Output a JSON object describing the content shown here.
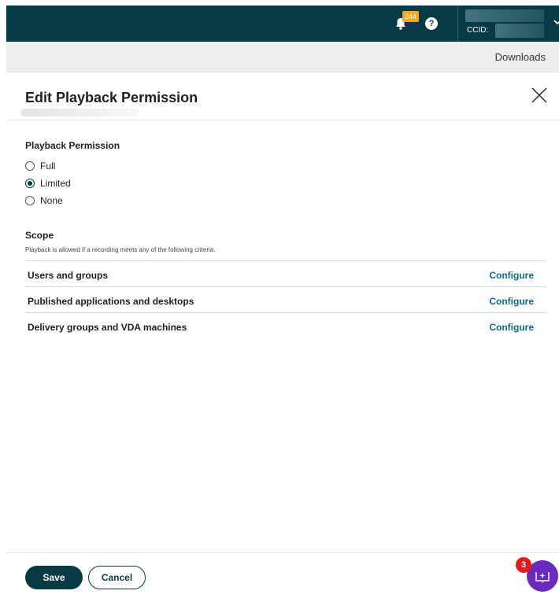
{
  "topbar": {
    "notification_count": "244",
    "help_glyph": "?",
    "ccid_label": "CCID:",
    "icons": [
      "bell-icon",
      "help-icon",
      "chevron-down-icon"
    ],
    "background_color": "#063b45",
    "badge_color": "#f5a623"
  },
  "subbar": {
    "downloads_label": "Downloads"
  },
  "panel": {
    "title": "Edit Playback Permission",
    "close_icon": "close-icon"
  },
  "playback_permission": {
    "label": "Playback Permission",
    "options": [
      {
        "label": "Full",
        "checked": false
      },
      {
        "label": "Limited",
        "checked": true
      },
      {
        "label": "None",
        "checked": false
      }
    ]
  },
  "scope": {
    "label": "Scope",
    "description": "Playback is allowed if a recording meets any of the following criteria.",
    "rows": [
      {
        "label": "Users and groups",
        "action": "Configure"
      },
      {
        "label": "Published applications and desktops",
        "action": "Configure"
      },
      {
        "label": "Delivery groups and VDA machines",
        "action": "Configure"
      }
    ],
    "link_color": "#0d6e80"
  },
  "footer": {
    "save_label": "Save",
    "cancel_label": "Cancel",
    "primary_color": "#063b45"
  },
  "assistant": {
    "badge_count": "3",
    "icon": "book-sparkle-icon",
    "color": "#6a2bbd"
  }
}
